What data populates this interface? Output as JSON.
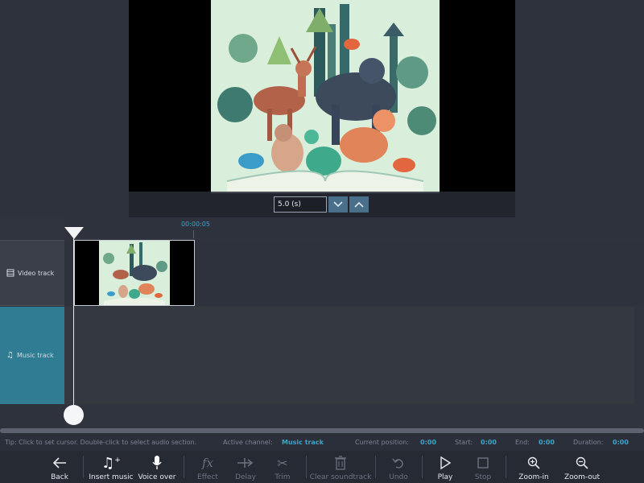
{
  "preview": {
    "duration_value": "5.0 (s)"
  },
  "timeline": {
    "ruler_time": "00:00:05",
    "video_track_label": "Video track",
    "music_track_label": "Music track"
  },
  "status": {
    "tip": "Tip: Click to set cursor. Double-click to select audio section.",
    "active_channel_label": "Active channel:",
    "active_channel_value": "Music track",
    "current_position_label": "Current position:",
    "current_position_value": "0:00",
    "start_label": "Start:",
    "start_value": "0:00",
    "end_label": "End:",
    "end_value": "0:00",
    "duration_label": "Duration:",
    "duration_value": "0:00"
  },
  "toolbar": {
    "back": "Back",
    "insert_music": "Insert music",
    "voice_over": "Voice over",
    "effect": "Effect",
    "delay": "Delay",
    "trim": "Trim",
    "clear_soundtrack": "Clear soundtrack",
    "undo": "Undo",
    "play": "Play",
    "stop": "Stop",
    "zoom_in": "Zoom-in",
    "zoom_out": "Zoom-out"
  },
  "colors": {
    "accent": "#3ea4c9",
    "music_track_active": "#2f7c93"
  }
}
